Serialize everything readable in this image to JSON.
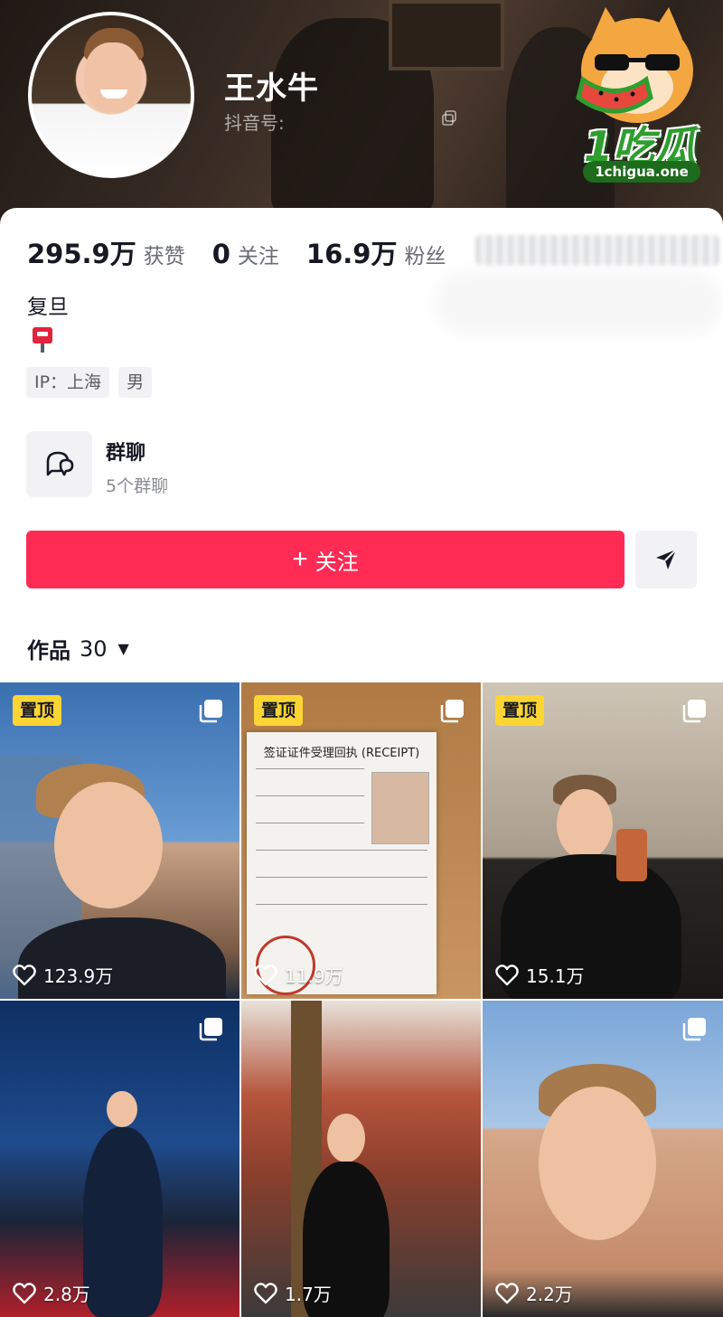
{
  "profile": {
    "username": "王水牛",
    "douyin_id_label": "抖音号:",
    "bio": "复旦",
    "tags": [
      "IP：上海",
      "男"
    ]
  },
  "watermark": {
    "logo_text": "1吃瓜",
    "url": "1chigua.one"
  },
  "stats": [
    {
      "value": "295.9万",
      "label": "获赞"
    },
    {
      "value": "0",
      "label": "关注"
    },
    {
      "value": "16.9万",
      "label": "粉丝"
    }
  ],
  "group_chat": {
    "title": "群聊",
    "subtitle": "5个群聊"
  },
  "actions": {
    "follow_label": "关注",
    "follow_plus": "+"
  },
  "works": {
    "tab_label": "作品",
    "count": "30"
  },
  "videos": [
    {
      "pinned_label": "置顶",
      "likes": "123.9万"
    },
    {
      "pinned_label": "置顶",
      "likes": "11.9万",
      "doc_title": "签证证件受理回执 (RECEIPT)"
    },
    {
      "pinned_label": "置顶",
      "likes": "15.1万"
    },
    {
      "pinned_label": "",
      "likes": "2.8万"
    },
    {
      "pinned_label": "",
      "likes": "1.7万"
    },
    {
      "pinned_label": "",
      "likes": "2.2万"
    }
  ],
  "colors": {
    "accent": "#fe2c55",
    "pin": "#fcd535",
    "text": "#161823",
    "muted": "#6b6d75"
  },
  "icons": [
    "copy-icon",
    "mailbox-icon",
    "group-chat-icon",
    "share-icon",
    "caret-down-icon",
    "multi-image-icon",
    "heart-icon"
  ]
}
